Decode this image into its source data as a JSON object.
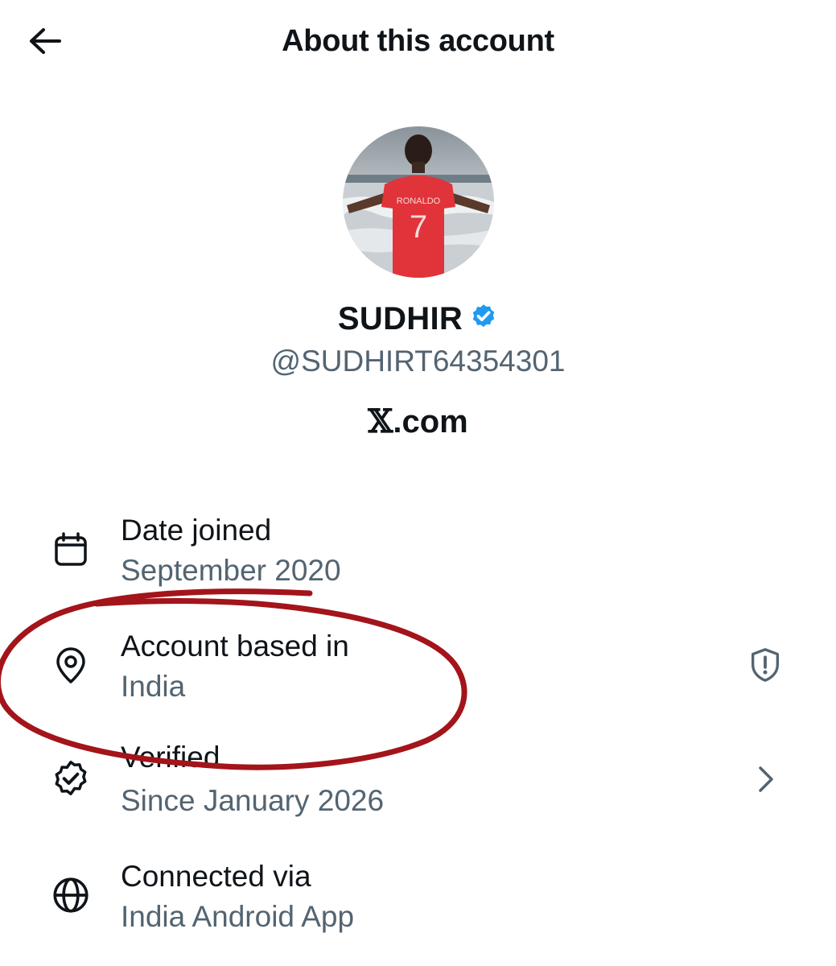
{
  "header": {
    "title": "About this account",
    "back_icon": "arrow-left-icon"
  },
  "profile": {
    "display_name": "SUDHIR",
    "handle": "@SUDHIRT64354301",
    "verified_badge_color": "#1d9bf0",
    "platform_glyph": "𝕏",
    "platform_suffix": ".com",
    "avatar_jersey_text": "RONALDO",
    "avatar_jersey_number": "7"
  },
  "details": [
    {
      "icon": "calendar-icon",
      "title": "Date joined",
      "value": "September 2020"
    },
    {
      "icon": "location-pin-icon",
      "title": "Account based in",
      "value": "India",
      "right_icon": "shield-alert-icon"
    },
    {
      "icon": "verified-badge-icon",
      "title": "Verified",
      "value": "Since January 2026",
      "right_icon": "chevron-right-icon"
    },
    {
      "icon": "globe-icon",
      "title": "Connected via",
      "value": "India Android App"
    }
  ],
  "colors": {
    "text": "#0f1419",
    "secondary": "#536471",
    "annotation": "#a3141b"
  }
}
